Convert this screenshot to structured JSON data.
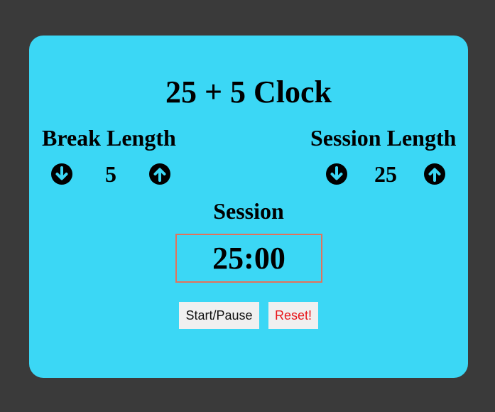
{
  "app": {
    "title": "25 + 5 Clock"
  },
  "break": {
    "label": "Break Length",
    "value": "5",
    "decrement_icon": "arrow-circle-down-icon",
    "increment_icon": "arrow-circle-up-icon"
  },
  "session": {
    "label": "Session Length",
    "value": "25",
    "decrement_icon": "arrow-circle-down-icon",
    "increment_icon": "arrow-circle-up-icon"
  },
  "timer": {
    "label": "Session",
    "time_left": "25:00"
  },
  "controls": {
    "start_pause_label": "Start/Pause",
    "reset_label": "Reset!"
  },
  "colors": {
    "background": "#3a3a3a",
    "card": "#3bd7f5",
    "timer_border": "#e2725b",
    "reset_text": "#e8161b"
  }
}
